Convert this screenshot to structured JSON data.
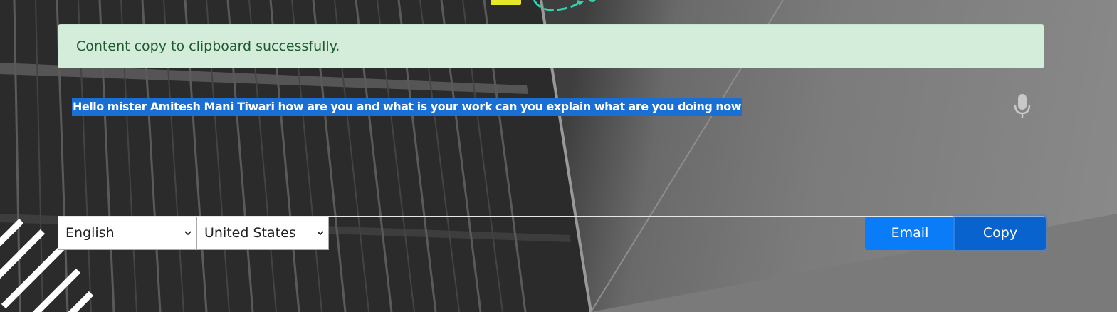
{
  "alert": {
    "message": "Content copy to clipboard successfully."
  },
  "editor": {
    "text": "Hello mister Amitesh Mani Tiwari how are you and what is your work can you explain what are you doing now",
    "mic_icon": "microphone-icon"
  },
  "language_select": {
    "selected": "English"
  },
  "country_select": {
    "selected": "United States"
  },
  "buttons": {
    "email_label": "Email",
    "copy_label": "Copy"
  },
  "colors": {
    "alert_bg": "#d4eddb",
    "alert_text": "#1f5a2f",
    "selection": "#1a6fd4",
    "email_button": "#0a7cf8",
    "copy_button": "#0863cf",
    "deco_yellow": "#e4e826",
    "deco_teal": "#2fd3b0"
  }
}
